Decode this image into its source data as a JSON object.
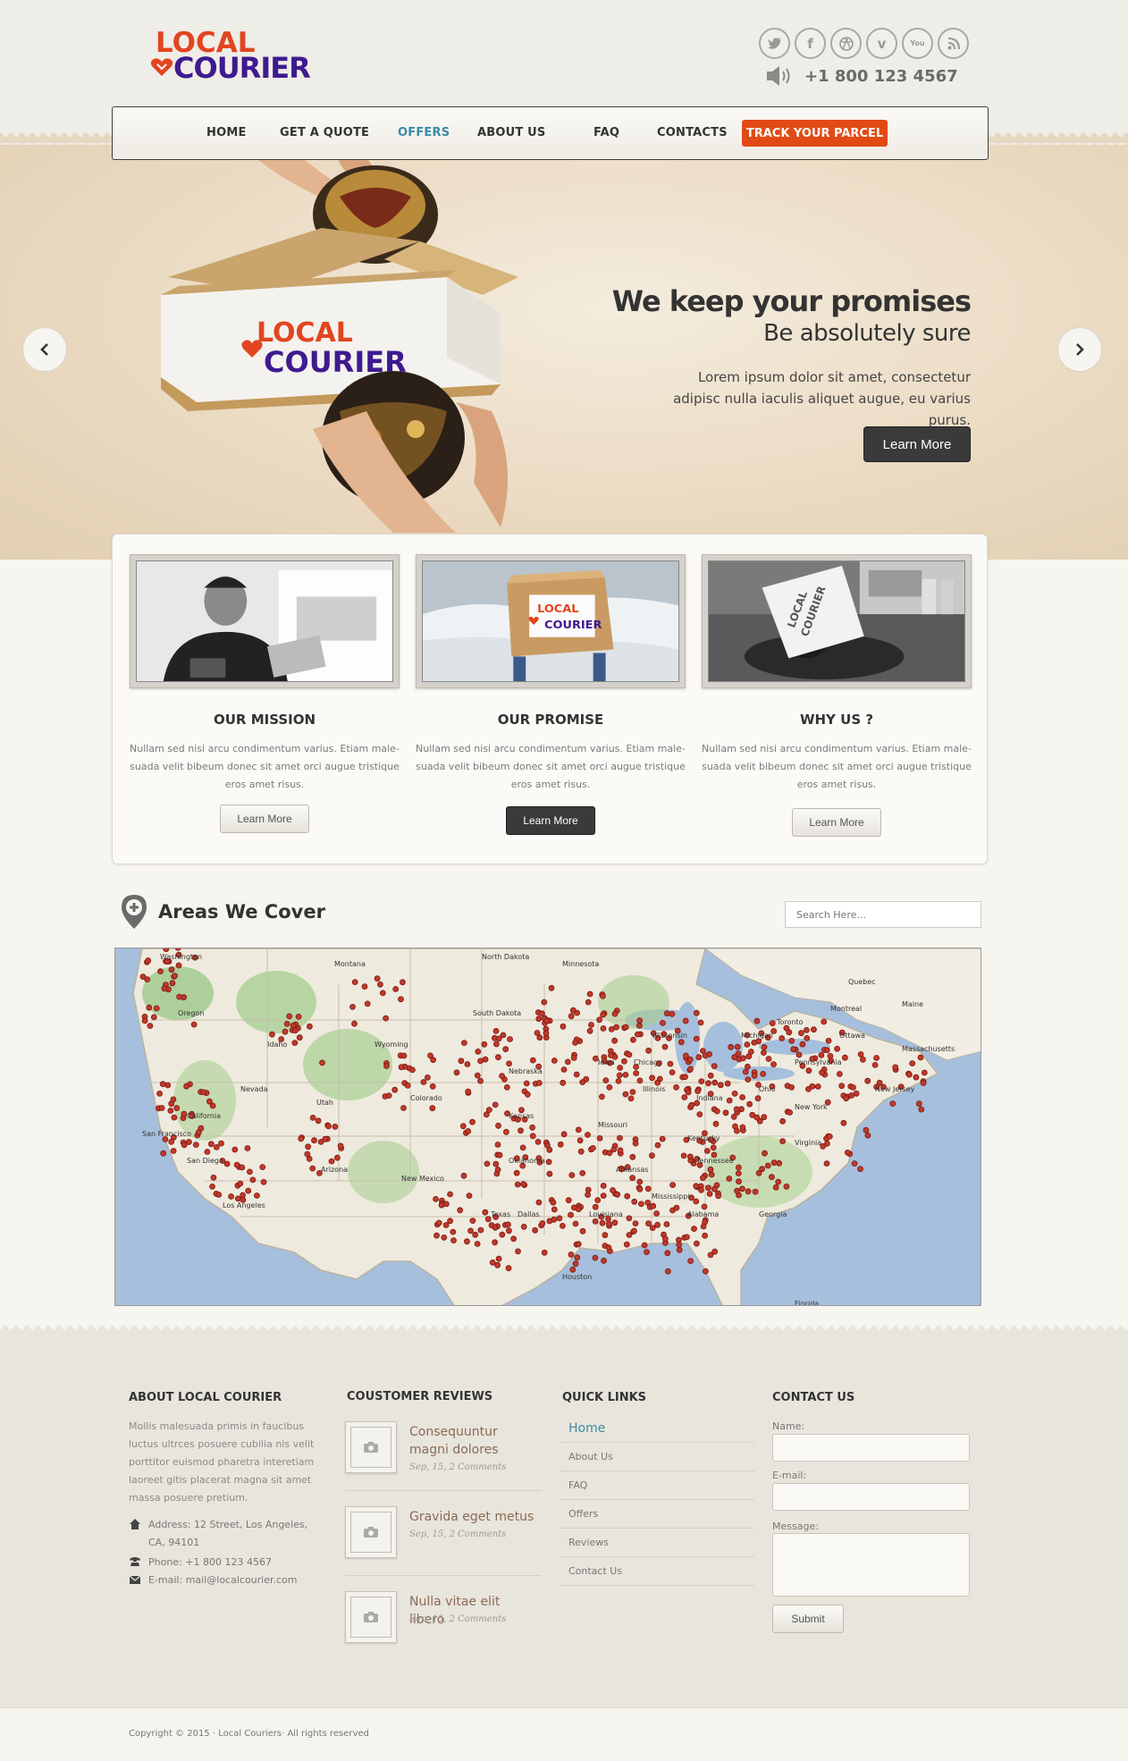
{
  "brand": {
    "line1": "LOCAL",
    "line2": "COURIER",
    "primary": "#e2451f",
    "secondary": "#3f1a8f"
  },
  "social": [
    {
      "name": "twitter-icon",
      "glyph": "🐦"
    },
    {
      "name": "facebook-icon",
      "glyph": "f"
    },
    {
      "name": "dribbble-icon",
      "glyph": "◎"
    },
    {
      "name": "vimeo-icon",
      "glyph": "v"
    },
    {
      "name": "youtube-icon",
      "glyph": "You"
    },
    {
      "name": "rss-icon",
      "glyph": "))"
    }
  ],
  "header": {
    "phone": "+1 800 123 4567"
  },
  "nav": {
    "items": [
      "HOME",
      "GET A QUOTE",
      "OFFERS",
      "ABOUT US",
      "FAQ",
      "CONTACTS"
    ],
    "active": "OFFERS",
    "cta": "TRACK YOUR PARCEL",
    "cta_color": "#e14a14",
    "active_color": "#3c8aa6"
  },
  "hero": {
    "title": "We keep your promises",
    "subtitle": "Be absolutely sure",
    "text": "Lorem ipsum dolor sit amet, consectetur adipisc nulla iaculis aliquet augue, eu varius purus.",
    "button": "Learn More",
    "box_line1": "LOCAL",
    "box_line2": "COURIER"
  },
  "features": [
    {
      "title": "OUR MISSION",
      "text": "Nullam sed nisi arcu condimentum varius. Etiam male-suada velit bibeum donec sit amet orci augue tristique eros amet risus.",
      "button": "Learn More",
      "style": "light"
    },
    {
      "title": "OUR PROMISE",
      "text": "Nullam sed nisi arcu condimentum varius. Etiam male-suada velit bibeum donec sit amet orci augue tristique eros amet risus.",
      "button": "Learn More",
      "style": "dark",
      "box_line1": "LOCAL",
      "box_line2": "COURIER"
    },
    {
      "title": "WHY US ?",
      "text": "Nullam sed nisi arcu condimentum varius. Etiam male-suada velit bibeum donec sit amet orci augue tristique eros amet risus.",
      "button": "Learn More",
      "style": "light",
      "box_line1": "LOCAL",
      "box_line2": "COURIER"
    }
  ],
  "areas": {
    "title": "Areas We Cover",
    "search_placeholder": "Search Here...",
    "map_labels": [
      "Washington",
      "Montana",
      "North Dakota",
      "Minnesota",
      "Oregon",
      "Idaho",
      "South Dakota",
      "Wyoming",
      "Nebraska",
      "Nevada",
      "Utah",
      "Colorado",
      "Kansas",
      "Missouri",
      "Illinois",
      "Indiana",
      "Ohio",
      "California",
      "Arizona",
      "New Mexico",
      "Oklahoma",
      "Texas",
      "Arkansas",
      "Tennessee",
      "Mississippi",
      "Alabama",
      "Georgia",
      "Louisiana",
      "Kentucky",
      "Virginia",
      "Pennsylvania",
      "New York",
      "Michigan",
      "Wisconsin",
      "Iowa",
      "Quebec",
      "Ottawa",
      "Montreal",
      "Toronto",
      "Maine",
      "Massachusetts",
      "New Jersey",
      "Florida",
      "San Francisco",
      "Los Angeles",
      "San Diego",
      "Houston",
      "Dallas",
      "Chicago"
    ]
  },
  "footer": {
    "about": {
      "title": "ABOUT LOCAL COURIER",
      "text": "Mollis malesuada primis in faucibus luctus ultrces posuere cubilia nis velit porttitor euismod pharetra interetiam laoreet gitis placerat magna sit amet massa posuere pretium.",
      "address_label": "Address:",
      "address": "12 Street, Los Angeles, CA, 94101",
      "phone_label": "Phone:",
      "phone": "+1 800 123 4567",
      "email_label": "E-mail:",
      "email": "mail@localcourier.com"
    },
    "reviews": {
      "title": "COUSTOMER REVIEWS",
      "items": [
        {
          "title": "Consequuntur magni dolores",
          "meta": "Sep, 15,  2 Comments"
        },
        {
          "title": "Gravida eget metus",
          "meta": "Sep, 15,  2 Comments"
        },
        {
          "title": "Nulla vitae elit libero",
          "meta": "Sep, 15,  2 Comments"
        }
      ]
    },
    "links": {
      "title": "QUICK LINKS",
      "items": [
        "Home",
        "About Us",
        "FAQ",
        "Offers",
        "Reviews",
        "Contact Us"
      ]
    },
    "contact": {
      "title": "CONTACT US",
      "name_label": "Name:",
      "email_label": "E-mail:",
      "message_label": "Message:",
      "submit": "Submit"
    },
    "copyright": "Copyright © 2015 ·  Local Couriers·  All rights reserved"
  }
}
